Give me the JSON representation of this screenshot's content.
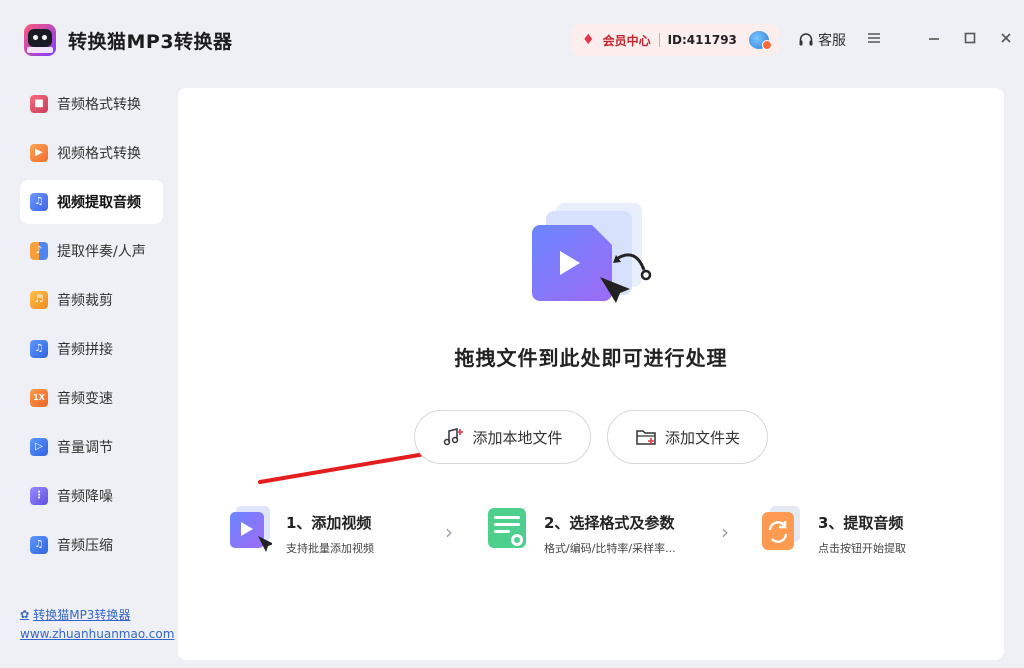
{
  "app": {
    "title": "转换猫MP3转换器"
  },
  "header": {
    "vip_label": "会员中心",
    "user_id": "ID:411793",
    "service_label": "客服",
    "menu_icon": "hamburger-icon",
    "minimize_icon": "minimize-icon",
    "maximize_icon": "maximize-icon",
    "close_icon": "close-icon"
  },
  "sidebar": {
    "items": [
      {
        "label": "音频格式转换",
        "icon": "audio-convert-icon",
        "color": "#e95a6e"
      },
      {
        "label": "视频格式转换",
        "icon": "video-convert-icon",
        "color": "#f28a3c"
      },
      {
        "label": "视频提取音频",
        "icon": "video-extract-audio-icon",
        "color": "#4a7ff0"
      },
      {
        "label": "提取伴奏/人声",
        "icon": "vocal-extract-icon",
        "color": "#f29a3a"
      },
      {
        "label": "音频裁剪",
        "icon": "audio-cut-icon",
        "color": "#f3a12f"
      },
      {
        "label": "音频拼接",
        "icon": "audio-merge-icon",
        "color": "#3f80ef"
      },
      {
        "label": "音频变速",
        "icon": "audio-speed-icon",
        "color": "#f07a3c",
        "badge": "1X"
      },
      {
        "label": "音量调节",
        "icon": "volume-icon",
        "color": "#3f80ef"
      },
      {
        "label": "音频降噪",
        "icon": "denoise-icon",
        "color": "#7a6cf0"
      },
      {
        "label": "音频压缩",
        "icon": "audio-compress-icon",
        "color": "#3f80ef"
      }
    ],
    "active_index": 2
  },
  "footer": {
    "brand_link": "转换猫MP3转换器",
    "site_link": "www.zhuanhuanmao.com"
  },
  "main": {
    "drop_text": "拖拽文件到此处即可进行处理",
    "add_file_label": "添加本地文件",
    "add_folder_label": "添加文件夹",
    "steps": [
      {
        "title": "1、添加视频",
        "desc": "支持批量添加视频"
      },
      {
        "title": "2、选择格式及参数",
        "desc": "格式/编码/比特率/采样率..."
      },
      {
        "title": "3、提取音频",
        "desc": "点击按钮开始提取"
      }
    ]
  },
  "colors": {
    "accent": "#5d6bf5",
    "annotation_arrow": "#e41d1d",
    "link": "#3665c9"
  }
}
